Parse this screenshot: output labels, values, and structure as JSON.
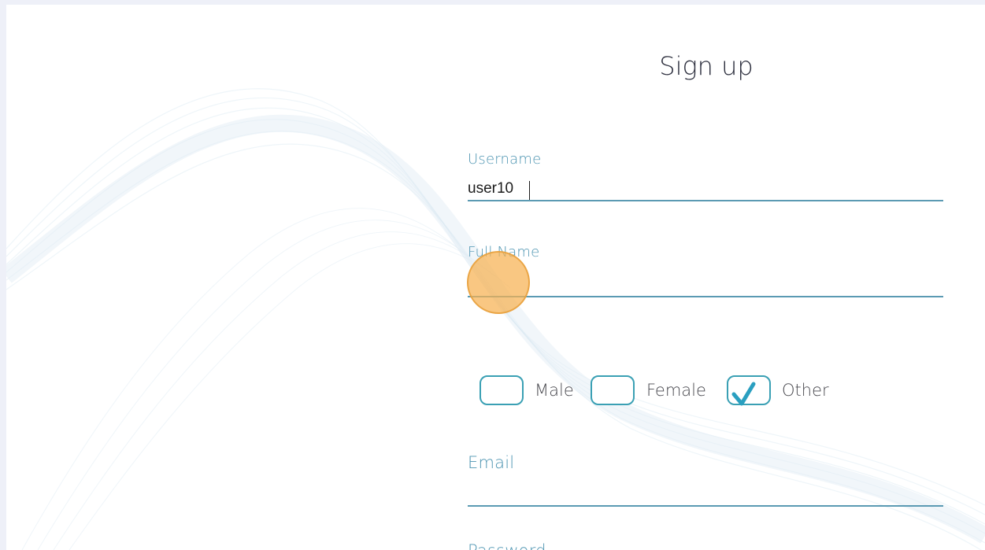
{
  "form": {
    "title": "Sign up",
    "username": {
      "label": "Username",
      "value": "user10"
    },
    "full_name": {
      "label": "Full Name",
      "value": ""
    },
    "gender": {
      "options": [
        {
          "label": "Male",
          "checked": false
        },
        {
          "label": "Female",
          "checked": false
        },
        {
          "label": "Other",
          "checked": true
        }
      ]
    },
    "email": {
      "label": "Email",
      "value": ""
    },
    "password": {
      "label": "Password"
    }
  },
  "colors": {
    "accent": "#3aa0b4",
    "label": "#4e95b2",
    "title": "#2d2f3e",
    "click_indicator": "#f6b252",
    "background": "#ffffff",
    "outer_background": "#eef0f8"
  },
  "icons": {
    "checkmark": "checkmark-icon"
  }
}
